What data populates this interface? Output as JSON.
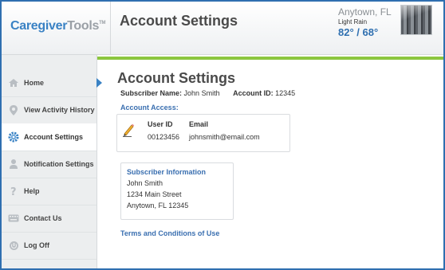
{
  "header": {
    "logo_part1": "Caregiver",
    "logo_part2": "Tools",
    "logo_tm": "TM",
    "title": "Account Settings",
    "weather": {
      "city": "Anytown, FL",
      "condition": "Light Rain",
      "temps": "82° / 68°"
    }
  },
  "sidebar": {
    "items": [
      {
        "label": "Home",
        "icon": "home-icon"
      },
      {
        "label": "View Activity History",
        "icon": "map-pin-icon"
      },
      {
        "label": "Account Settings",
        "icon": "gear-icon"
      },
      {
        "label": "Notification Settings",
        "icon": "person-icon"
      },
      {
        "label": "Help",
        "icon": "question-icon"
      },
      {
        "label": "Contact Us",
        "icon": "keyboard-icon"
      },
      {
        "label": "Log Off",
        "icon": "power-icon"
      }
    ],
    "active_index": 2
  },
  "main": {
    "title": "Account Settings",
    "subscriber_name_label": "Subscriber Name:",
    "subscriber_name": "John Smith",
    "account_id_label": "Account ID:",
    "account_id": "12345",
    "account_access_label": "Account Access:",
    "access_table": {
      "headers": [
        "User ID",
        "Email"
      ],
      "row": [
        "00123456",
        "johnsmith@email.com"
      ]
    },
    "subscriber_info": {
      "title": "Subscriber Information",
      "lines": [
        "John Smith",
        "1234 Main Street",
        "Anytown, FL 12345"
      ]
    },
    "terms_link": "Terms and Conditions of Use"
  },
  "colors": {
    "accent_blue": "#3a82c4",
    "green_bar": "#8cc63f",
    "frame_border": "#2f6fb0"
  }
}
